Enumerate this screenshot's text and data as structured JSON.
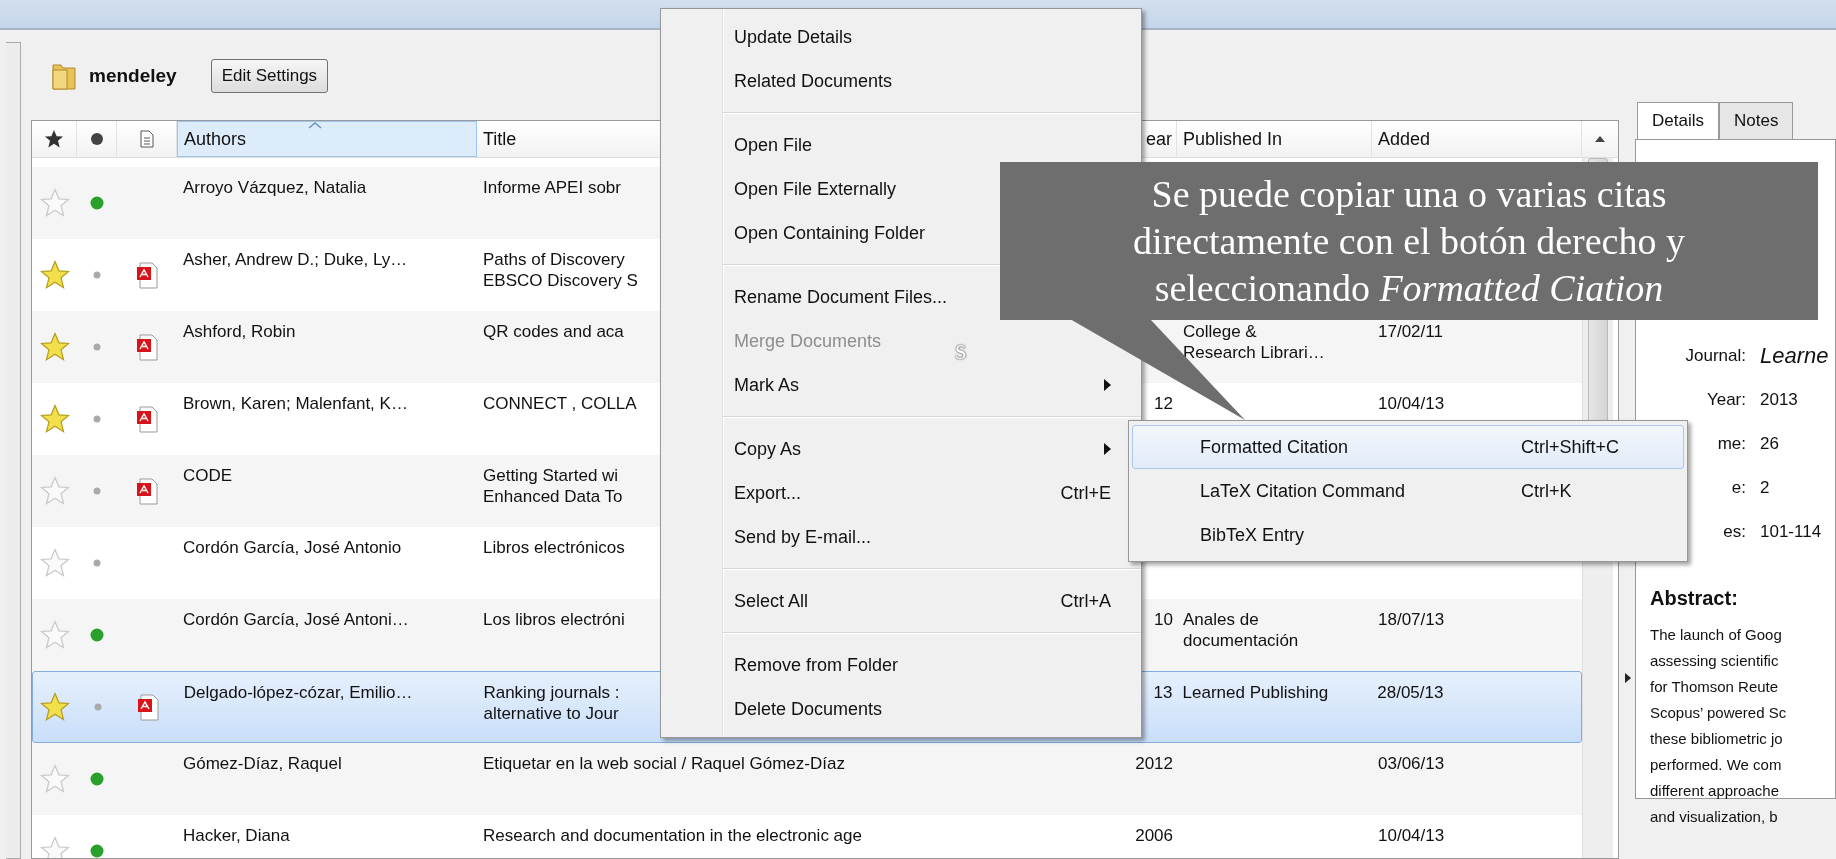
{
  "folder": {
    "name": "mendeley",
    "button": "Edit Settings"
  },
  "table": {
    "columns": [
      {
        "label": "Authors",
        "sorted": true
      },
      {
        "label": "Title",
        "sorted": false
      },
      {
        "label": "ear",
        "sorted": false
      },
      {
        "label": "Published In",
        "sorted": false
      },
      {
        "label": "Added",
        "sorted": false
      }
    ],
    "rows": [
      {
        "starred": false,
        "unread": true,
        "pdf": false,
        "selected": false,
        "authors": "Arroyo Vázquez, Natalia",
        "title": [
          "Informe APEI sobr"
        ]
      },
      {
        "starred": true,
        "unread": false,
        "pdf": true,
        "selected": false,
        "authors": "Asher, Andrew D.; Duke, Ly…",
        "title": [
          "Paths of Discovery",
          "EBSCO Discovery S"
        ]
      },
      {
        "starred": true,
        "unread": false,
        "pdf": true,
        "selected": false,
        "authors": "Ashford, Robin",
        "title": [
          "QR codes and aca"
        ],
        "published": [
          "College &",
          "Research Librari…"
        ],
        "added": "17/02/11"
      },
      {
        "starred": true,
        "unread": false,
        "pdf": true,
        "selected": false,
        "authors": "Brown, Karen; Malenfant, K…",
        "title": [
          "CONNECT , COLLA"
        ],
        "year": "12",
        "added": "10/04/13"
      },
      {
        "starred": false,
        "unread": false,
        "pdf": true,
        "selected": false,
        "authors": "CODE",
        "title": [
          "Getting Started wi",
          "Enhanced Data To"
        ]
      },
      {
        "starred": false,
        "unread": false,
        "pdf": false,
        "selected": false,
        "authors": "Cordón García, José Antonio",
        "title": [
          "Libros electrónicos"
        ]
      },
      {
        "starred": false,
        "unread": true,
        "pdf": false,
        "selected": false,
        "authors": "Cordón García, José Antoni…",
        "title": [
          "Los libros electróni"
        ],
        "year": "10",
        "published": [
          "Anales de",
          "documentación"
        ],
        "added": "18/07/13"
      },
      {
        "starred": true,
        "unread": false,
        "pdf": true,
        "selected": true,
        "authors": "Delgado-lópez-cózar, Emilio…",
        "title": [
          "Ranking journals :",
          "alternative to Jour"
        ],
        "year": "13",
        "published": [
          "Learned Publishing"
        ],
        "added": "28/05/13"
      },
      {
        "starred": false,
        "unread": true,
        "pdf": false,
        "selected": false,
        "authors": "Gómez-Díaz, Raquel",
        "title": [
          "Etiquetar en la web social / Raquel Gómez-Díaz"
        ],
        "year": "2012",
        "added": "03/06/13"
      },
      {
        "starred": false,
        "unread": true,
        "pdf": false,
        "selected": false,
        "authors": "Hacker, Diana",
        "title": [
          "Research and documentation in the electronic age"
        ],
        "year": "2006",
        "added": "10/04/13"
      }
    ]
  },
  "details": {
    "tabs": [
      {
        "label": "Details",
        "selected": true
      },
      {
        "label": "Notes",
        "selected": false
      }
    ],
    "fields": [
      {
        "label": "Journal:",
        "value": "Learne",
        "kind": "italic"
      },
      {
        "label": "Year:",
        "value": "2013",
        "kind": "plain"
      },
      {
        "label": "me:",
        "value": "26",
        "kind": "plain"
      },
      {
        "label": "e:",
        "value": "2",
        "kind": "plain"
      },
      {
        "label": "es:",
        "value": "101-114",
        "kind": "plain"
      }
    ],
    "abstract_heading": "Abstract:",
    "abstract_lines": [
      "The launch of Goog",
      "assessing scientific",
      "for Thomson Reute",
      "Scopus’ powered Sc",
      "these bibliometric jo",
      "performed. We com",
      "different approache",
      "and visualization, b"
    ]
  },
  "context_menu": {
    "groups": [
      [
        {
          "label": "Update Details",
          "submenu": false,
          "disabled": false
        },
        {
          "label": "Related Documents",
          "submenu": false,
          "disabled": false
        }
      ],
      [
        {
          "label": "Open File",
          "submenu": false,
          "disabled": false
        },
        {
          "label": "Open File Externally",
          "submenu": false,
          "disabled": false
        },
        {
          "label": "Open Containing Folder",
          "submenu": false,
          "disabled": false
        }
      ],
      [
        {
          "label": "Rename Document Files...",
          "submenu": false,
          "disabled": false
        },
        {
          "label": "Merge Documents",
          "submenu": false,
          "disabled": true
        },
        {
          "label": "Mark As",
          "submenu": true,
          "disabled": false
        }
      ],
      [
        {
          "label": "Copy As",
          "submenu": true,
          "disabled": false
        },
        {
          "label": "Export...",
          "shortcut": "Ctrl+E",
          "submenu": false,
          "disabled": false
        },
        {
          "label": "Send by E-mail...",
          "submenu": false,
          "disabled": false
        }
      ],
      [
        {
          "label": "Select All",
          "shortcut": "Ctrl+A",
          "submenu": false,
          "disabled": false
        }
      ],
      [
        {
          "label": "Remove from Folder",
          "submenu": false,
          "disabled": false
        },
        {
          "label": "Delete Documents",
          "submenu": false,
          "disabled": false
        }
      ]
    ]
  },
  "submenu": {
    "items": [
      {
        "label": "Formatted Citation",
        "shortcut": "Ctrl+Shift+C",
        "selected": true
      },
      {
        "label": "LaTeX Citation Command",
        "shortcut": "Ctrl+K",
        "selected": false
      },
      {
        "label": "BibTeX Entry",
        "selected": false
      }
    ]
  },
  "callout": {
    "lines": [
      "Se puede copiar una o varias citas",
      "directamente con el botón derecho y",
      "seleccionando *Formatted Ciation*"
    ],
    "stray_text": "s"
  }
}
